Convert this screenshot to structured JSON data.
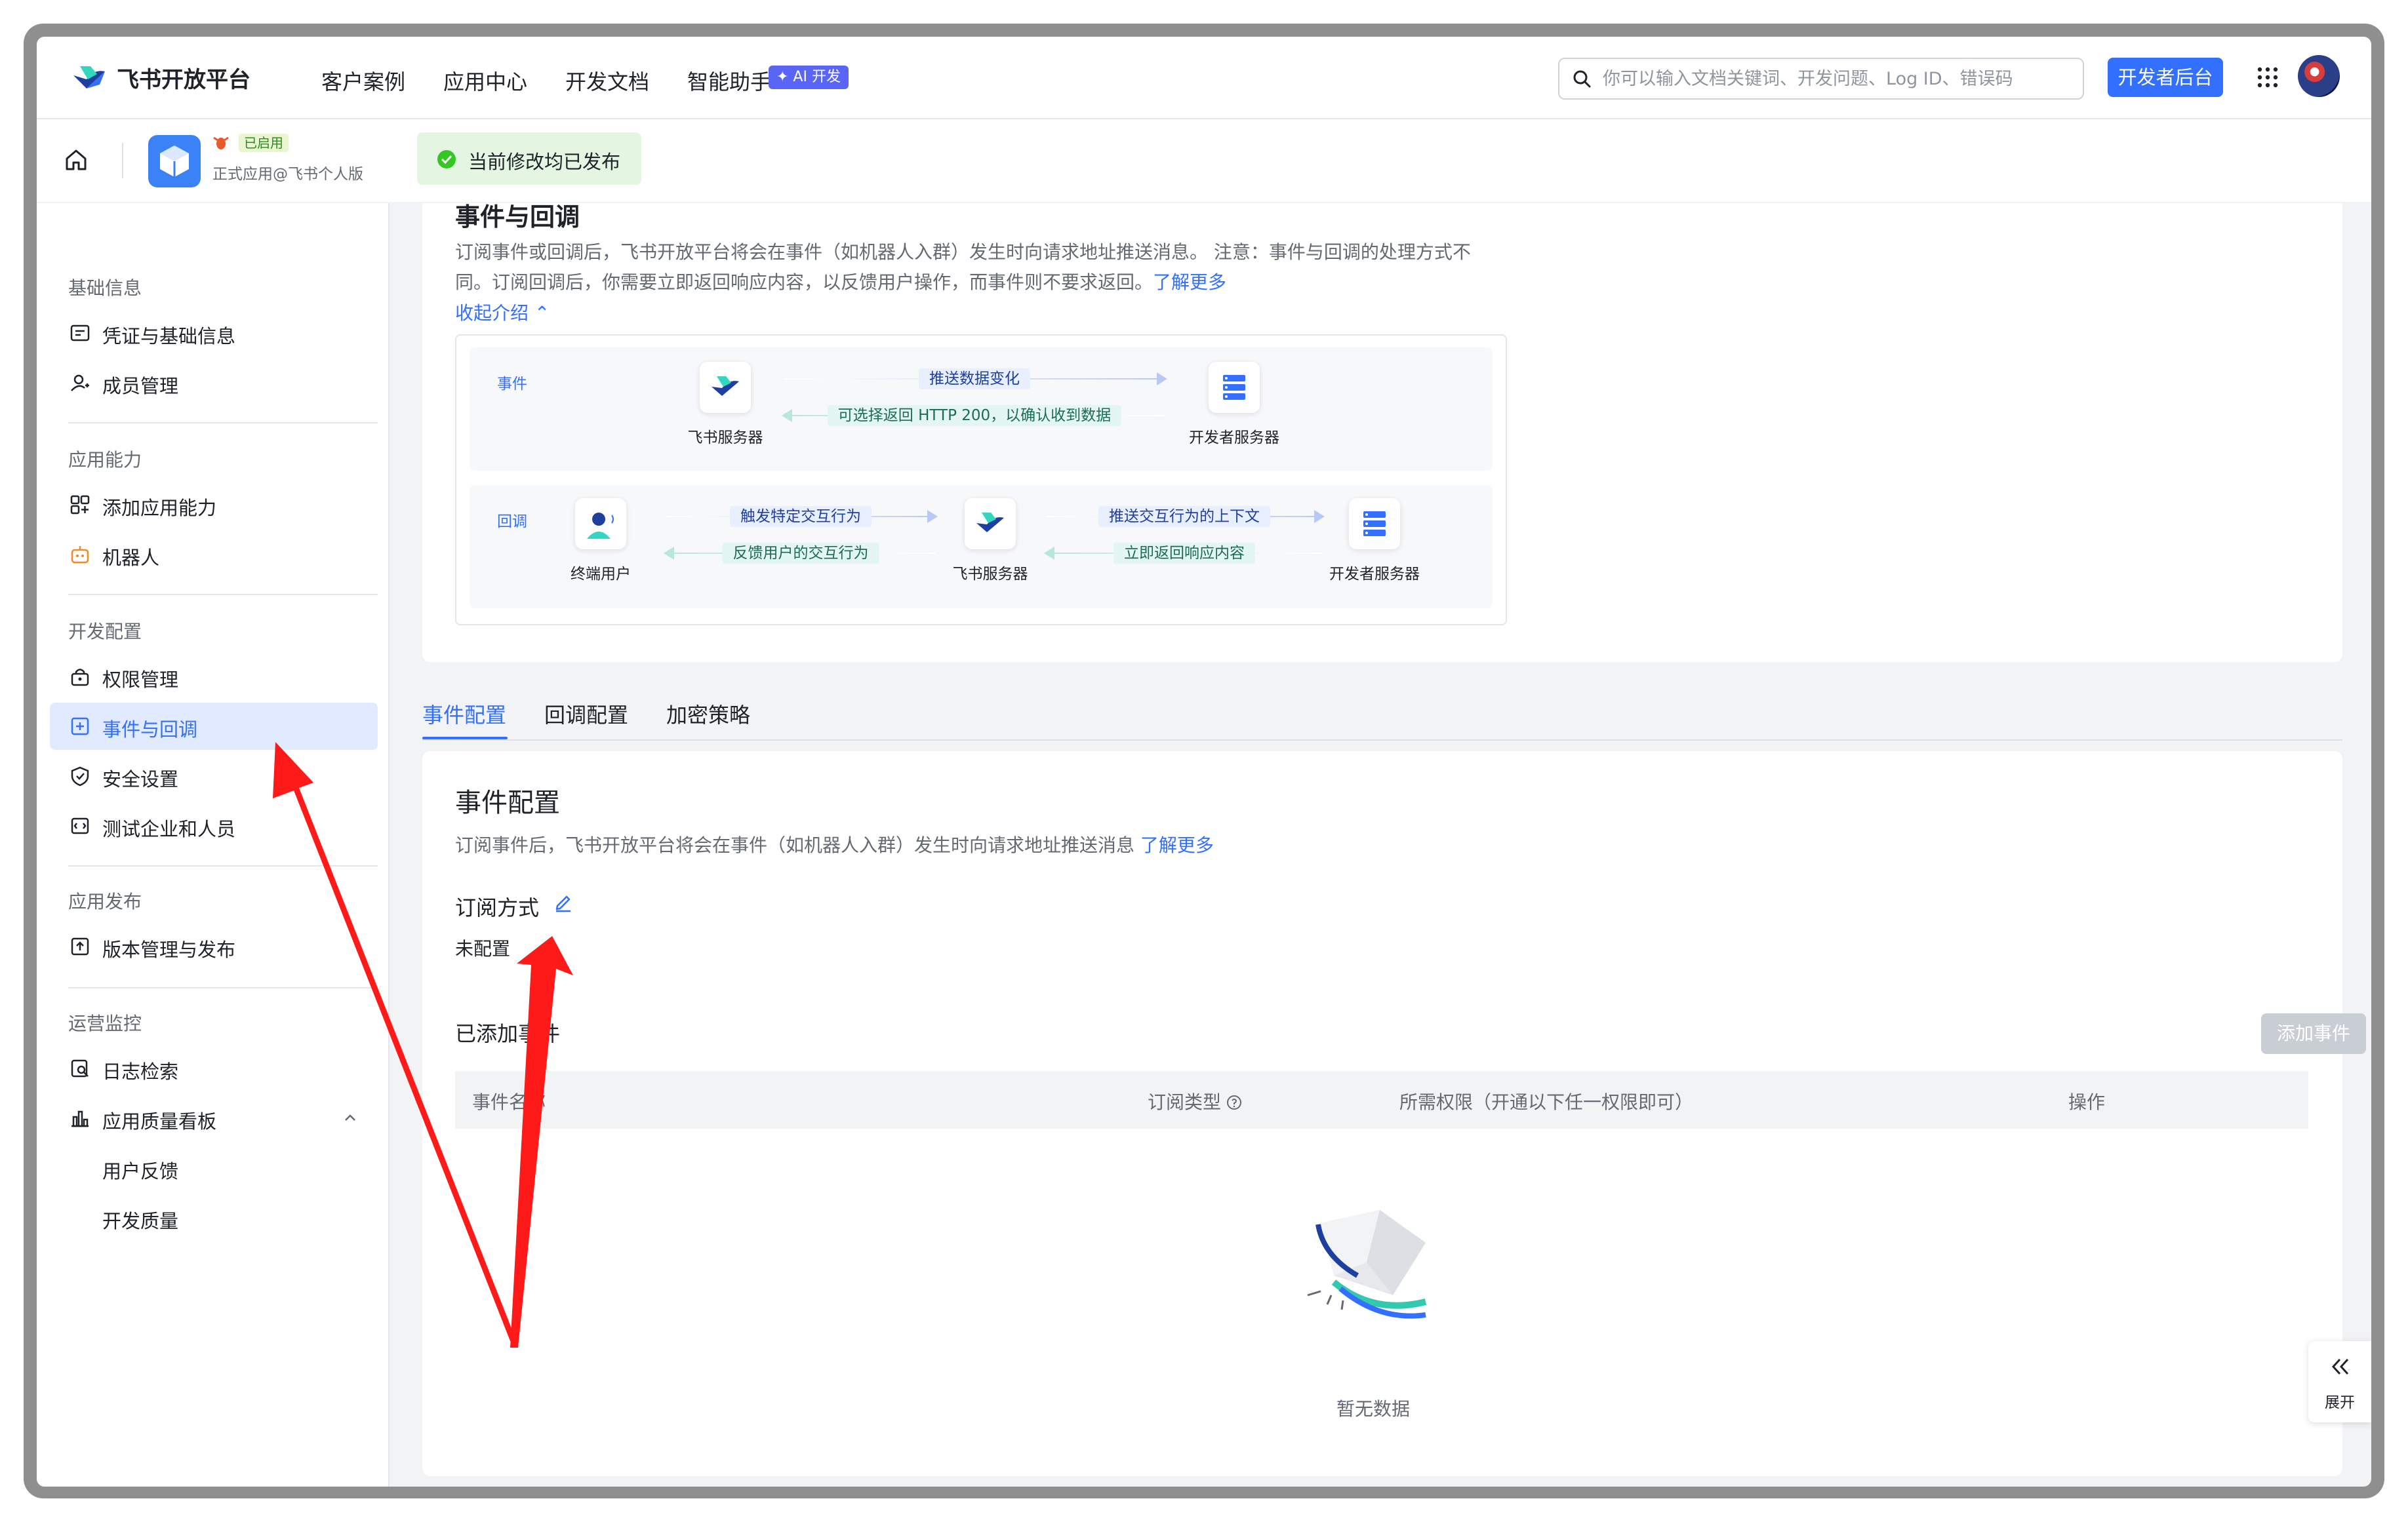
{
  "header": {
    "brand": "飞书开放平台",
    "nav": [
      "客户案例",
      "应用中心",
      "开发文档",
      "智能助手"
    ],
    "ai_badge": "✦ AI 开发",
    "search_placeholder": "你可以输入文档关键词、开发问题、Log ID、错误码",
    "dev_console_label": "开发者后台"
  },
  "app_bar": {
    "status": "已启用",
    "app_type": "正式应用@飞书个人版",
    "publish_status": "当前修改均已发布"
  },
  "sidebar": {
    "groups": [
      {
        "title": "基础信息",
        "items": [
          {
            "label": "凭证与基础信息",
            "icon": "credential-icon"
          },
          {
            "label": "成员管理",
            "icon": "member-icon"
          }
        ]
      },
      {
        "title": "应用能力",
        "items": [
          {
            "label": "添加应用能力",
            "icon": "add-capability-icon"
          },
          {
            "label": "机器人",
            "icon": "robot-icon"
          }
        ]
      },
      {
        "title": "开发配置",
        "items": [
          {
            "label": "权限管理",
            "icon": "permission-icon"
          },
          {
            "label": "事件与回调",
            "icon": "event-icon",
            "active": true
          },
          {
            "label": "安全设置",
            "icon": "shield-icon"
          },
          {
            "label": "测试企业和人员",
            "icon": "test-icon"
          }
        ]
      },
      {
        "title": "应用发布",
        "items": [
          {
            "label": "版本管理与发布",
            "icon": "version-icon"
          }
        ]
      },
      {
        "title": "运营监控",
        "items": [
          {
            "label": "日志检索",
            "icon": "log-search-icon"
          },
          {
            "label": "应用质量看板",
            "icon": "chart-icon",
            "expanded": true
          },
          {
            "label": "用户反馈",
            "sub": true
          },
          {
            "label": "开发质量",
            "sub": true
          }
        ]
      }
    ]
  },
  "intro": {
    "title": "事件与回调",
    "desc_1": "订阅事件或回调后，飞书开放平台将会在事件（如机器人入群）发生时向请求地址推送消息。 注意：事件与回调的处理方式不",
    "desc_2": "同。订阅回调后，你需要立即返回响应内容，以反馈用户操作，而事件则不要求返回。",
    "learn_more": "了解更多",
    "collapse": "收起介绍 ⌃",
    "event_lane": {
      "tag": "事件",
      "source": "飞书服务器",
      "target": "开发者服务器",
      "forward": "推送数据变化",
      "back": "可选择返回 HTTP 200，以确认收到数据"
    },
    "callback_lane": {
      "tag": "回调",
      "user": "终端用户",
      "middle": "飞书服务器",
      "target": "开发者服务器",
      "forward_1": "触发特定交互行为",
      "back_1": "反馈用户的交互行为",
      "forward_2": "推送交互行为的上下文",
      "back_2": "立即返回响应内容"
    }
  },
  "tabs": [
    "事件配置",
    "回调配置",
    "加密策略"
  ],
  "event_config": {
    "title": "事件配置",
    "desc": "订阅事件后，飞书开放平台将会在事件（如机器人入群）发生时向请求地址推送消息",
    "learn_more": "了解更多",
    "subscribe_label": "订阅方式",
    "subscribe_value": "未配置",
    "added_label": "已添加事件",
    "add_button": "添加事件",
    "columns": [
      "事件名称",
      "订阅类型",
      "所需权限（开通以下任一权限即可）",
      "操作"
    ],
    "empty": "暂无数据"
  },
  "expand_label": "展开",
  "colors": {
    "primary": "#3370ff",
    "annotation": "#ff1a1a"
  }
}
